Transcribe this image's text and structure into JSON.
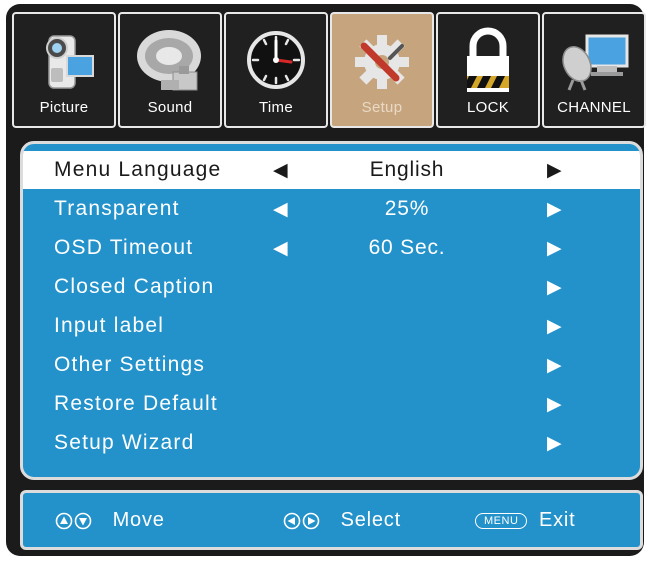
{
  "tabs": [
    {
      "label": "Picture",
      "icon": "camcorder-icon",
      "active": false
    },
    {
      "label": "Sound",
      "icon": "speaker-icon",
      "active": false
    },
    {
      "label": "Time",
      "icon": "clock-icon",
      "active": false
    },
    {
      "label": "Setup",
      "icon": "gear-icon",
      "active": true
    },
    {
      "label": "LOCK",
      "icon": "padlock-icon",
      "active": false
    },
    {
      "label": "CHANNEL",
      "icon": "satellite-dish-icon",
      "active": false
    }
  ],
  "menu": {
    "rows": [
      {
        "label": "Menu Language",
        "value": "English",
        "has_left_arrow": true,
        "selected": true
      },
      {
        "label": "Transparent",
        "value": "25%",
        "has_left_arrow": true,
        "selected": false
      },
      {
        "label": "OSD Timeout",
        "value": "60 Sec.",
        "has_left_arrow": true,
        "selected": false
      },
      {
        "label": "Closed Caption",
        "value": "",
        "has_left_arrow": false,
        "selected": false
      },
      {
        "label": "Input label",
        "value": "",
        "has_left_arrow": false,
        "selected": false
      },
      {
        "label": "Other Settings",
        "value": "",
        "has_left_arrow": false,
        "selected": false
      },
      {
        "label": "Restore Default",
        "value": "",
        "has_left_arrow": false,
        "selected": false
      },
      {
        "label": "Setup Wizard",
        "value": "",
        "has_left_arrow": false,
        "selected": false
      }
    ],
    "left_arrow_glyph": "◀",
    "right_arrow_glyph": "▶"
  },
  "footer": {
    "move_label": "Move",
    "select_label": "Select",
    "menu_key_label": "MENU",
    "exit_label": "Exit"
  },
  "colors": {
    "panel_blue": "#2392ca",
    "active_tab": "#c6a57e",
    "frame": "#1b1b1b",
    "selected_row": "#ffffff"
  }
}
